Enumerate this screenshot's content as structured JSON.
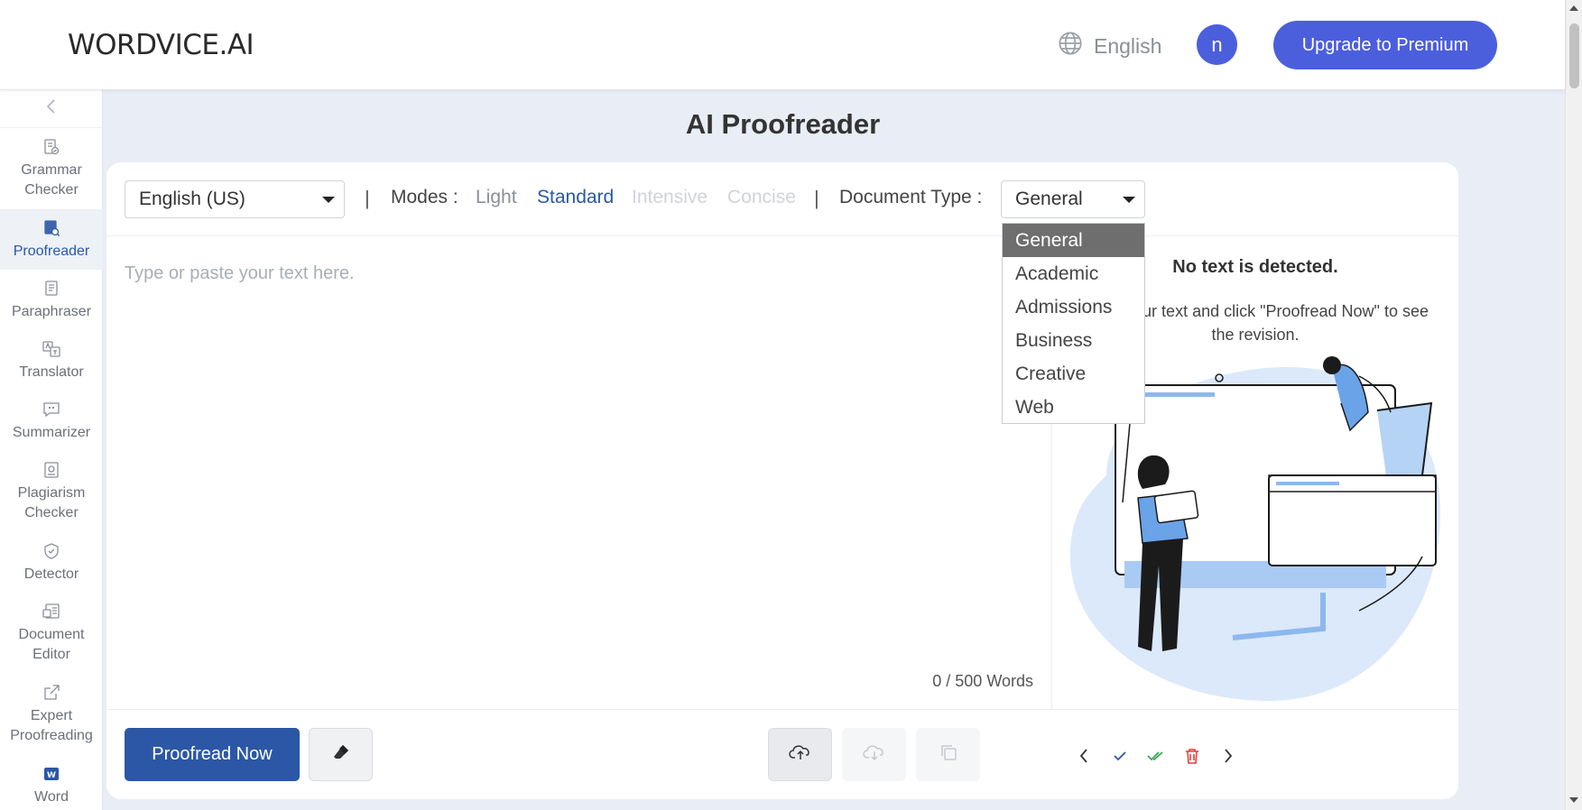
{
  "header": {
    "logo": "WORDVICE.AI",
    "language": "English",
    "avatar_initial": "n",
    "upgrade_label": "Upgrade to Premium"
  },
  "sidebar": {
    "items": [
      {
        "label": "Grammar Checker",
        "icon": "grammar-check-icon"
      },
      {
        "label": "Proofreader",
        "icon": "proofreader-icon",
        "active": true
      },
      {
        "label": "Paraphraser",
        "icon": "paraphraser-icon"
      },
      {
        "label": "Translator",
        "icon": "translator-icon"
      },
      {
        "label": "Summarizer",
        "icon": "summarizer-icon"
      },
      {
        "label": "Plagiarism Checker",
        "icon": "plagiarism-icon"
      },
      {
        "label": "Detector",
        "icon": "detector-icon"
      },
      {
        "label": "Document Editor",
        "icon": "document-editor-icon"
      },
      {
        "label": "Expert Proofreading",
        "icon": "external-link-icon"
      },
      {
        "label": "Word",
        "icon": "word-icon"
      }
    ]
  },
  "main": {
    "title": "AI Proofreader",
    "language_select": "English (US)",
    "separator": "|",
    "modes_label": "Modes :",
    "modes": [
      {
        "label": "Light",
        "state": "available"
      },
      {
        "label": "Standard",
        "state": "selected"
      },
      {
        "label": "Intensive",
        "state": "disabled"
      },
      {
        "label": "Concise",
        "state": "disabled"
      }
    ],
    "doc_type_label": "Document Type :",
    "doc_type_value": "General",
    "editor_placeholder": "Type or paste your text here.",
    "word_count": "0 / 500 Words",
    "no_text_title": "No text is detected.",
    "no_text_hint": "Enter your text and click \"Proofread Now\" to see the revision.",
    "proofread_button": "Proofread Now"
  },
  "dropdown": {
    "options": [
      "General",
      "Academic",
      "Admissions",
      "Business",
      "Creative",
      "Web"
    ],
    "selected": "General"
  },
  "colors": {
    "brand": "#4b5fdc",
    "primary": "#2b57a6",
    "accept_green": "#3aa757",
    "delete_red": "#e0413a"
  }
}
